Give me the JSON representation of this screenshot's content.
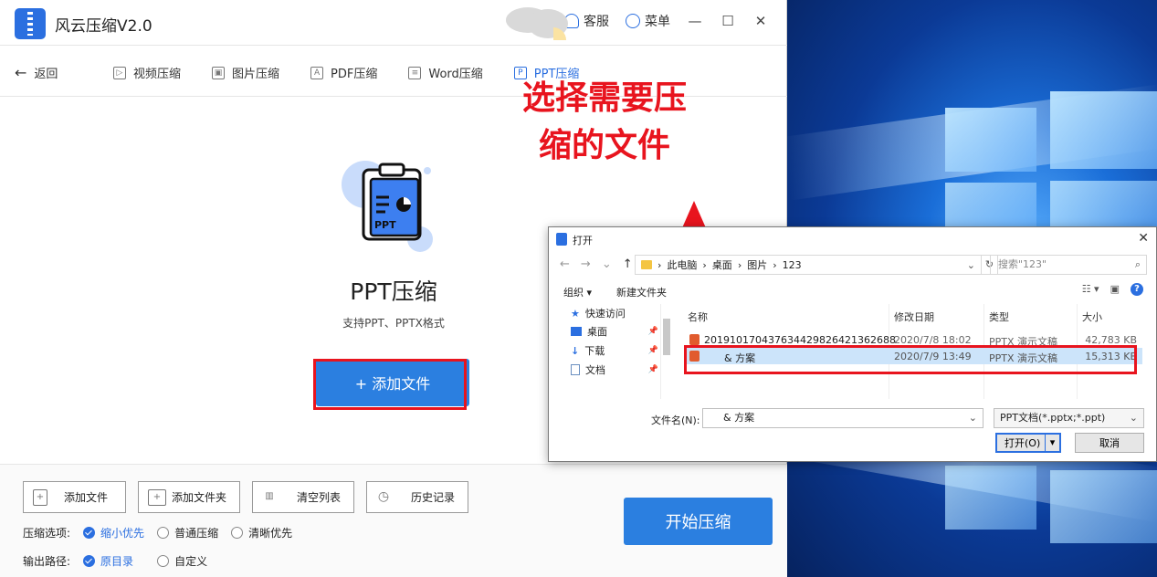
{
  "app": {
    "title": "风云压缩V2.0",
    "service_label": "客服",
    "menu_label": "菜单",
    "minimize": "—",
    "maximize": "☐",
    "close": "✕"
  },
  "nav": {
    "back_label": "返回",
    "tabs": [
      {
        "label": "视频压缩",
        "icon": "▷",
        "active": false
      },
      {
        "label": "图片压缩",
        "icon": "▣",
        "active": false
      },
      {
        "label": "PDF压缩",
        "icon": "A",
        "active": false
      },
      {
        "label": "Word压缩",
        "icon": "≡",
        "active": false
      },
      {
        "label": "PPT压缩",
        "icon": "P",
        "active": true
      }
    ]
  },
  "hero": {
    "icon_text": "PPT",
    "title": "PPT压缩",
    "subtitle": "支持PPT、PPTX格式",
    "add_button": "+ 添加文件"
  },
  "bottom": {
    "buttons": [
      {
        "label": "添加文件",
        "icon": "+"
      },
      {
        "label": "添加文件夹",
        "icon": "+"
      },
      {
        "label": "清空列表",
        "icon": "▥"
      },
      {
        "label": "历史记录",
        "icon": "◷"
      }
    ],
    "compress_options_label": "压缩选项:",
    "compress_options": [
      {
        "label": "缩小优先",
        "selected": true
      },
      {
        "label": "普通压缩",
        "selected": false
      },
      {
        "label": "清晰优先",
        "selected": false
      }
    ],
    "output_path_label": "输出路径:",
    "output_options": [
      {
        "label": "原目录",
        "selected": true
      },
      {
        "label": "自定义",
        "selected": false
      }
    ],
    "start_button": "开始压缩"
  },
  "annotation": {
    "line1": "选择需要压",
    "line2": "缩的文件"
  },
  "dialog": {
    "title": "打开",
    "close": "✕",
    "breadcrumb": [
      "此电脑",
      "桌面",
      "图片",
      "123"
    ],
    "search_placeholder": "搜索\"123\"",
    "organize_label": "组织 ▾",
    "new_folder_label": "新建文件夹",
    "left_pane": [
      {
        "label": "快速访问",
        "icon_color": "#2b6fe0"
      },
      {
        "label": "桌面",
        "icon_color": "#2b6fe0"
      },
      {
        "label": "下载",
        "icon_color": "#2b6fe0"
      },
      {
        "label": "文档",
        "icon_color": "#6a8fc0"
      }
    ],
    "columns": {
      "name": "名称",
      "modified": "修改日期",
      "type": "类型",
      "size": "大小"
    },
    "files": [
      {
        "name": "20191017043763442982642136268​8",
        "modified": "2020/7/8 18:02",
        "type": "PPTX 演示文稿",
        "size": "42,783 KB",
        "selected": false
      },
      {
        "name": "&      方案",
        "modified": "2020/7/9 13:49",
        "type": "PPTX 演示文稿",
        "size": "15,313 KB",
        "selected": true
      }
    ],
    "filename_label": "文件名(N):",
    "filename_value": "&      方案",
    "filetype_value": "PPT文档(*.pptx;*.ppt)",
    "open_button": "打开(O)",
    "cancel_button": "取消"
  },
  "colors": {
    "accent": "#2b7fe0",
    "annotation": "#e8141e"
  }
}
